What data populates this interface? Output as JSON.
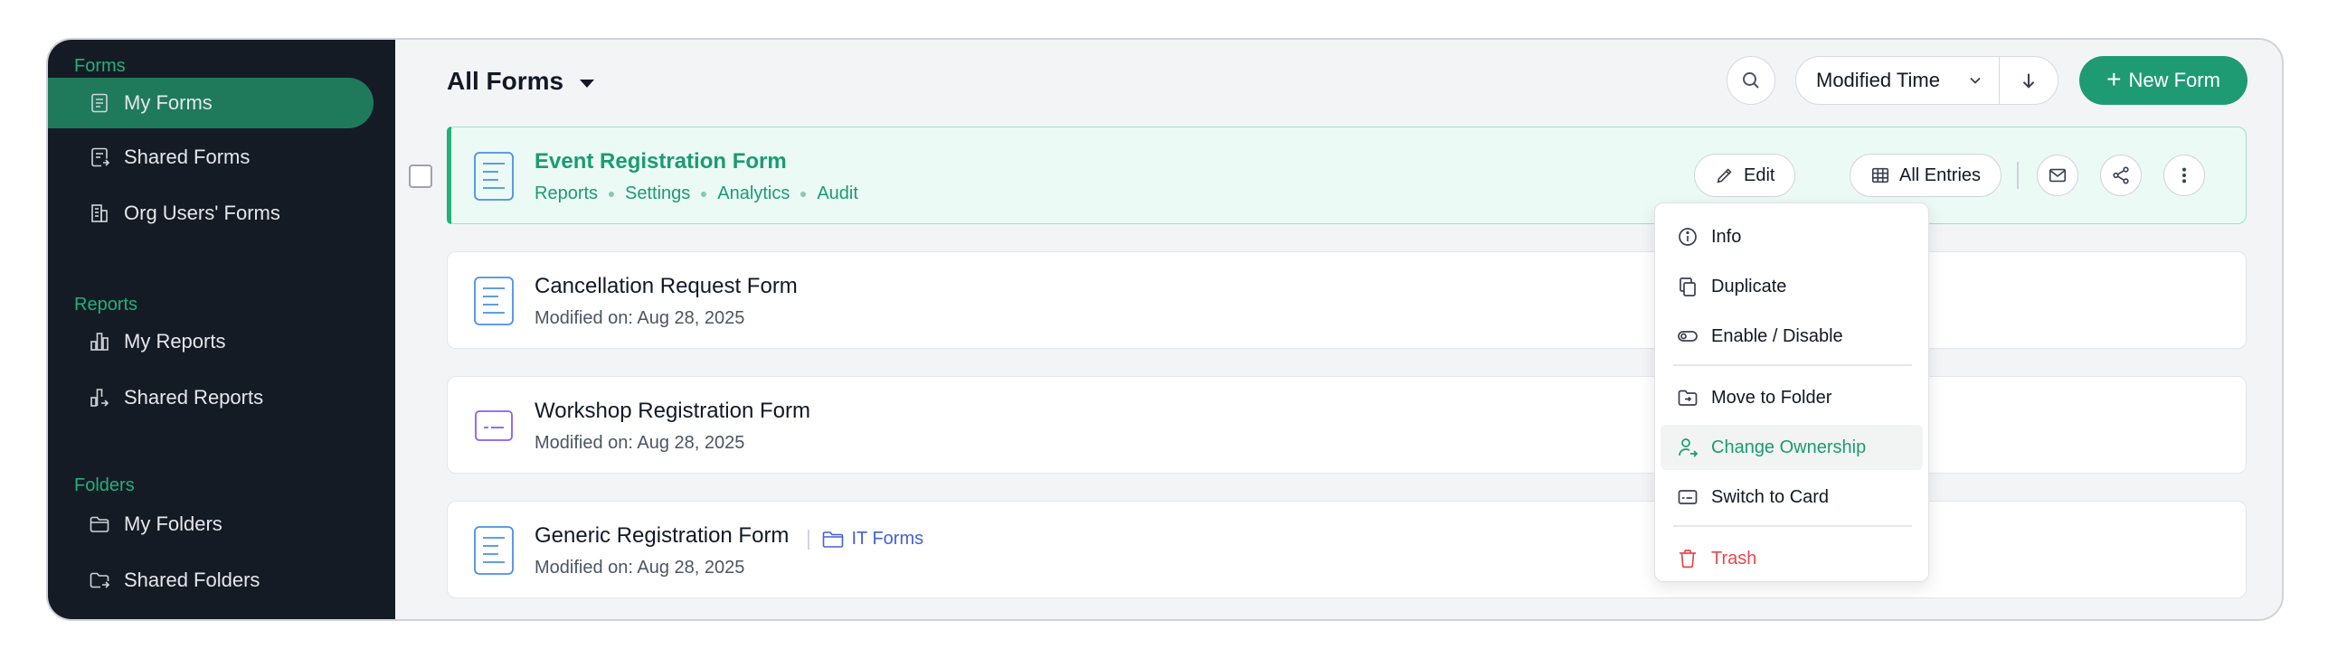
{
  "sidebar": {
    "sections": [
      {
        "heading": "Forms",
        "items": [
          {
            "label": "My Forms",
            "icon": "form-doc-icon",
            "active": true
          },
          {
            "label": "Shared Forms",
            "icon": "shared-form-icon"
          },
          {
            "label": "Org Users' Forms",
            "icon": "building-icon"
          }
        ]
      },
      {
        "heading": "Reports",
        "items": [
          {
            "label": "My Reports",
            "icon": "bar-chart-icon"
          },
          {
            "label": "Shared Reports",
            "icon": "shared-chart-icon"
          }
        ]
      },
      {
        "heading": "Folders",
        "items": [
          {
            "label": "My Folders",
            "icon": "folder-icon"
          },
          {
            "label": "Shared Folders",
            "icon": "shared-folder-icon"
          }
        ]
      }
    ]
  },
  "header": {
    "title": "All Forms",
    "sort_label": "Modified Time",
    "new_form_label": "New Form"
  },
  "forms": [
    {
      "title": "Event Registration Form",
      "links": [
        "Reports",
        "Settings",
        "Analytics",
        "Audit"
      ],
      "edit_label": "Edit",
      "entries_label": "All Entries"
    },
    {
      "title": "Cancellation Request Form",
      "modified": "Modified on: Aug 28, 2025"
    },
    {
      "title": "Workshop Registration Form",
      "modified": "Modified on: Aug 28, 2025"
    },
    {
      "title": "Generic Registration Form",
      "modified": "Modified on: Aug 28, 2025",
      "folder": "IT Forms"
    }
  ],
  "menu": {
    "items": [
      {
        "label": "Info",
        "icon": "info-icon"
      },
      {
        "label": "Duplicate",
        "icon": "duplicate-icon"
      },
      {
        "label": "Enable / Disable",
        "icon": "toggle-icon"
      },
      {
        "label": "Move to Folder",
        "icon": "move-folder-icon"
      },
      {
        "label": "Change Ownership",
        "icon": "change-owner-icon",
        "active": true
      },
      {
        "label": "Switch to Card",
        "icon": "card-icon"
      },
      {
        "label": "Trash",
        "icon": "trash-icon",
        "danger": true
      }
    ]
  },
  "colors": {
    "accent": "#1f9b73",
    "sidebar_bg": "#151b24",
    "danger": "#e5484d",
    "folder_link": "#4360d8"
  }
}
